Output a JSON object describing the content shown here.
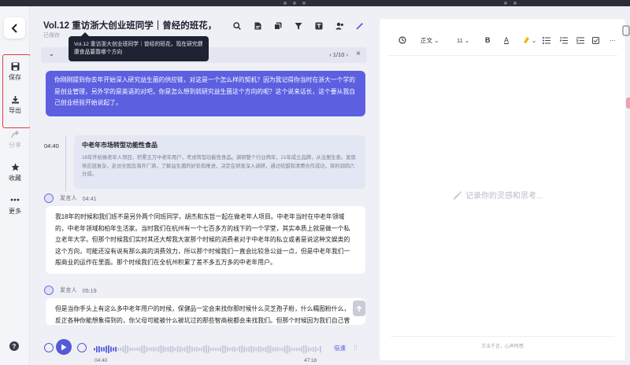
{
  "window": {
    "title": "Vol.12 重访浙大创业班同学｜曾经的班花，现在..."
  },
  "header": {
    "title": "Vol.12 重访浙大创业班同学｜曾经的班花，现在...",
    "saved": "已保存",
    "tooltip": "Vol.12 重访浙大创业班同学｜曾经的班花，现在研究健康食品要靠哪个方向"
  },
  "rail": {
    "save": "保存",
    "export": "导出",
    "share": "分享",
    "favorite": "收藏",
    "more": "更多",
    "help": "?"
  },
  "pager": {
    "label": "章",
    "page": "1/10"
  },
  "question": "你刚刚提到你去年开始深入研究益生菌的供应链，对这是一个怎么样的契机？因为我记得你当时在浙大一个学的是创业管理，另外学的是英语的对吧，你是怎么想到就研究益生菌这个方向的呢？这个说来话长，这个要从我自己创业经验开始说起了。",
  "chapter": {
    "time": "04:40",
    "title": "中老年市场转型功能性食品",
    "summary": "18年开始做老年人项目，积累五万中老年用户，考虑转型功能性食品。调研整个行业两年，21年成立品牌，从注册生意。发现供应链复杂，走访全国及海外厂商，了解益生菌的好处和推进，决定在研发深入调研，通过结盟和清费合作成功，将利润四六分成。"
  },
  "segments": [
    {
      "speaker": "发言人",
      "time": "04:41",
      "text": "我18年的时候和我们班不是另外两个同班同学，胡杰和东哲一起在做老年人项目。中老年当时在中老年领域的，中老年领域和柏年生活家。当时我们在杭州有一个七百多方的线下的一个学堂，其实本质上就是做一个私立老年大学。但那个时候我们实时其还大帮我大家那个时候的消费者对于中老年的私立或者是说这种文娱类的这个方向，可能还没有说有那么高的消费效力，所以那个时候我们一直会比较急公益一点，但是中老年我们一般商业的运作在里面。那个时候我们在全杭州积累了差不多五万多的中老年用户。"
    },
    {
      "speaker": "发言人",
      "time": "05:19",
      "text": "但是当你手头上有这么多中老年用户的时候，保健品一定会来找你那时候什么灵芝孢子粉，什么糯图粉什么，反正各种你能想象得到的，你父母可能被什么被坑过的那些智商税都会来找我们。但那个时候因为我们自己曾"
    }
  ],
  "player": {
    "current": "04:40",
    "duration": "47:18",
    "speed": "倍速",
    "progress": 0.099
  },
  "editor": {
    "tools": [
      "正文",
      "11",
      "B",
      "A"
    ],
    "placeholder": "记录你的灵感和思考...",
    "footer": "方法千言，心声所感"
  }
}
